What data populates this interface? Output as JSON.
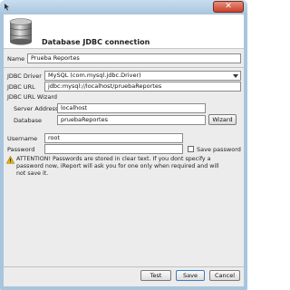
{
  "dialog": {
    "header_title": "Database JDBC connection"
  },
  "form": {
    "name_label": "Name",
    "name_value": "Prueba Reportes",
    "jdbc_driver_label": "JDBC Driver",
    "jdbc_driver_value": "MySQL (com.mysql.jdbc.Driver)",
    "jdbc_url_label": "JDBC URL",
    "jdbc_url_value": "jdbc:mysql://localhost/pruebaReportes",
    "wizard_section_label": "JDBC URL Wizard",
    "server_address_label": "Server Address",
    "server_address_value": "localhost",
    "database_label": "Database",
    "database_value": "pruebaReportes",
    "wizard_button": "Wizard",
    "username_label": "Username",
    "username_value": "root",
    "password_label": "Password",
    "password_value": "",
    "save_password_label": "Save password",
    "save_password_checked": false
  },
  "notice": {
    "text": "ATTENTION! Passwords are stored in clear text. If you dont specify a password now, iReport will ask you for one only when required and will not save it."
  },
  "buttons": {
    "test": "Test",
    "save": "Save",
    "cancel": "Cancel"
  },
  "colors": {
    "title_bar": "#a8c5dd",
    "close_button": "#c8412a",
    "warning_icon": "#e6b800"
  }
}
